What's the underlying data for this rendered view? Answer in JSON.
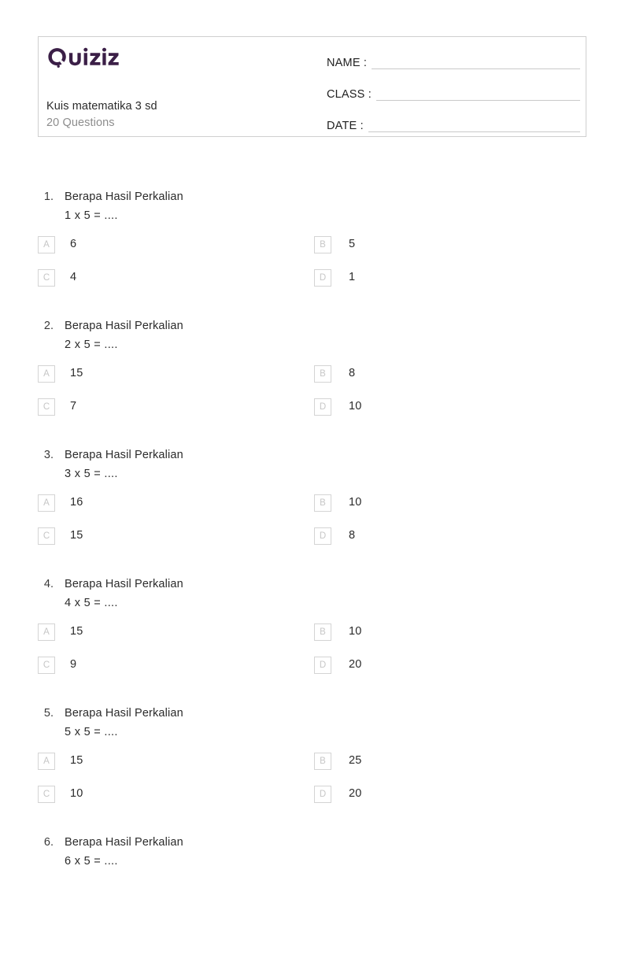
{
  "brand": {
    "name": "Quizizz",
    "logo_icon": "quizizz-logo-icon",
    "color": "#3b1f47"
  },
  "header": {
    "quiz_title": "Kuis matematika 3 sd",
    "question_count_label": "20 Questions",
    "fields": [
      {
        "label": "NAME :",
        "value": ""
      },
      {
        "label": "CLASS :",
        "value": ""
      },
      {
        "label": "DATE  :",
        "value": ""
      }
    ]
  },
  "questions": [
    {
      "number": "1.",
      "prompt": "Berapa Hasil Perkalian",
      "expression": "1 x 5 = ....",
      "options": [
        {
          "letter": "A",
          "text": "6"
        },
        {
          "letter": "B",
          "text": "5"
        },
        {
          "letter": "C",
          "text": "4"
        },
        {
          "letter": "D",
          "text": "1"
        }
      ]
    },
    {
      "number": "2.",
      "prompt": "Berapa Hasil Perkalian",
      "expression": "2 x 5 = ....",
      "options": [
        {
          "letter": "A",
          "text": "15"
        },
        {
          "letter": "B",
          "text": "8"
        },
        {
          "letter": "C",
          "text": "7"
        },
        {
          "letter": "D",
          "text": "10"
        }
      ]
    },
    {
      "number": "3.",
      "prompt": "Berapa Hasil Perkalian",
      "expression": "3 x 5 = ....",
      "options": [
        {
          "letter": "A",
          "text": "16"
        },
        {
          "letter": "B",
          "text": "10"
        },
        {
          "letter": "C",
          "text": "15"
        },
        {
          "letter": "D",
          "text": "8"
        }
      ]
    },
    {
      "number": "4.",
      "prompt": "Berapa Hasil Perkalian",
      "expression": "4 x 5 = ....",
      "options": [
        {
          "letter": "A",
          "text": "15"
        },
        {
          "letter": "B",
          "text": "10"
        },
        {
          "letter": "C",
          "text": "9"
        },
        {
          "letter": "D",
          "text": "20"
        }
      ]
    },
    {
      "number": "5.",
      "prompt": "Berapa Hasil Perkalian",
      "expression": "5 x 5 = ....",
      "options": [
        {
          "letter": "A",
          "text": "15"
        },
        {
          "letter": "B",
          "text": "25"
        },
        {
          "letter": "C",
          "text": "10"
        },
        {
          "letter": "D",
          "text": "20"
        }
      ]
    },
    {
      "number": "6.",
      "prompt": "Berapa Hasil Perkalian",
      "expression": "6 x 5 = ....",
      "options": []
    }
  ]
}
